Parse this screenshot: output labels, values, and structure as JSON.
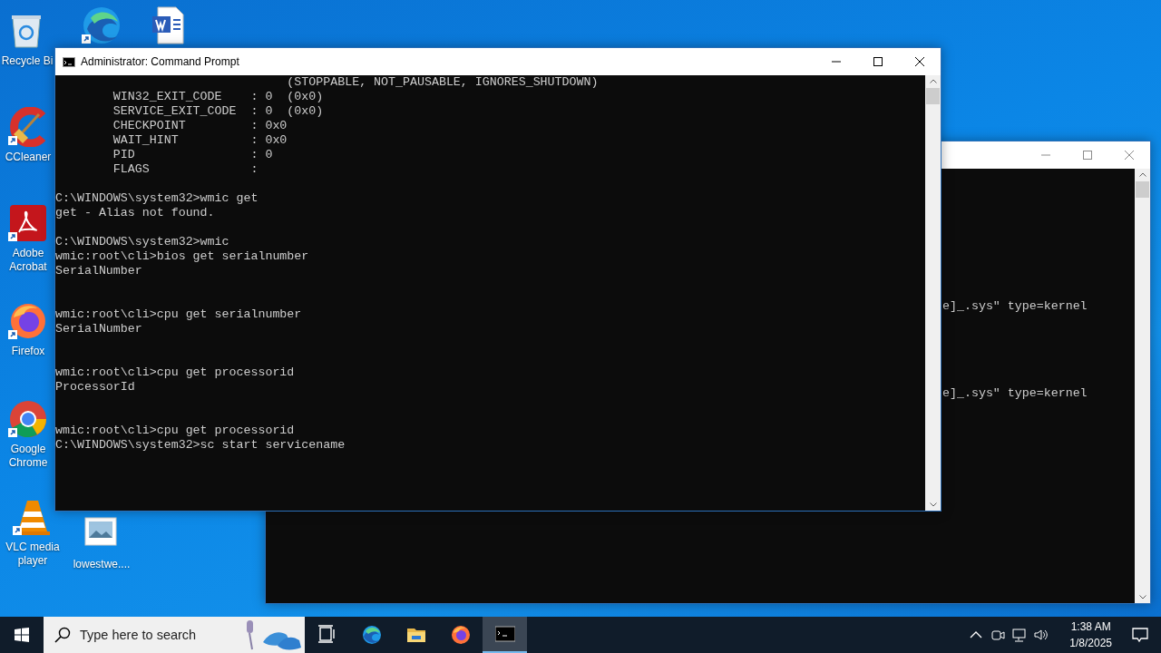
{
  "desktop_icons": [
    {
      "kind": "recycle",
      "label": "Recycle Bi"
    },
    {
      "kind": "edge"
    },
    {
      "kind": "word"
    },
    {
      "kind": "ccleaner",
      "label": "CCleaner"
    },
    {
      "kind": "acrobat",
      "label": "Adobe Acrobat"
    },
    {
      "kind": "firefox",
      "label": "Firefox"
    },
    {
      "kind": "chrome",
      "label": "Google Chrome"
    },
    {
      "kind": "vlc",
      "label": "VLC media player"
    },
    {
      "kind": "image",
      "label": "lowestwe...."
    }
  ],
  "back_window": {
    "lines": [
      "e]_.sys\" type=kernel",
      "e]_.sys\" type=kernel"
    ]
  },
  "cmd_window": {
    "title": "Administrator: Command Prompt",
    "output": "                                (STOPPABLE, NOT_PAUSABLE, IGNORES_SHUTDOWN)\n        WIN32_EXIT_CODE    : 0  (0x0)\n        SERVICE_EXIT_CODE  : 0  (0x0)\n        CHECKPOINT         : 0x0\n        WAIT_HINT          : 0x0\n        PID                : 0\n        FLAGS              :\n\nC:\\WINDOWS\\system32>wmic get\nget - Alias not found.\n\nC:\\WINDOWS\\system32>wmic\nwmic:root\\cli>bios get serialnumber\nSerialNumber\n\n\nwmic:root\\cli>cpu get serialnumber\nSerialNumber\n\n\nwmic:root\\cli>cpu get processorid\nProcessorId\n\n\nwmic:root\\cli>cpu get processorid\nC:\\WINDOWS\\system32>sc start servicename"
  },
  "taskbar": {
    "search": {
      "placeholder": "Type here to search"
    },
    "apps": [
      {
        "kind": "taskview",
        "active": false
      },
      {
        "kind": "edge",
        "active": false
      },
      {
        "kind": "explorer",
        "active": false
      },
      {
        "kind": "firefox",
        "active": false
      },
      {
        "kind": "cmd",
        "active": true
      }
    ],
    "tray": [
      {
        "kind": "chevron"
      },
      {
        "kind": "camera"
      },
      {
        "kind": "network"
      },
      {
        "kind": "volume"
      }
    ],
    "clock": {
      "time": "1:38 AM",
      "date": "1/8/2025"
    }
  }
}
